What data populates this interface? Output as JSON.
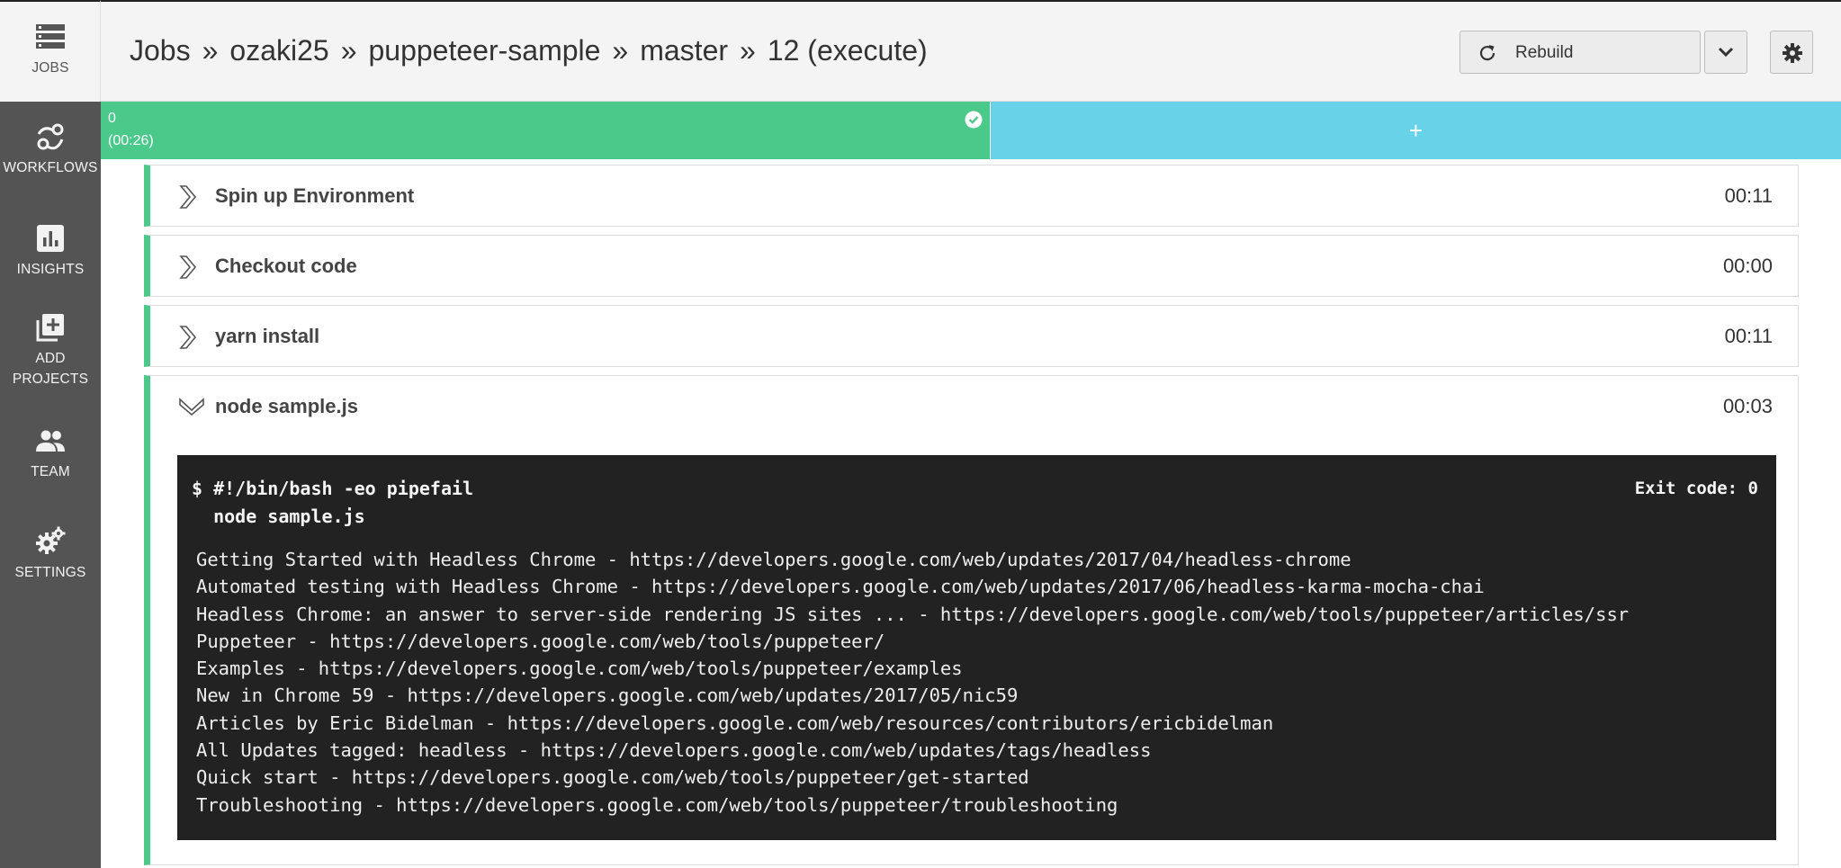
{
  "sidebar": {
    "jobs_label": "JOBS",
    "items": [
      {
        "label": "WORKFLOWS"
      },
      {
        "label": "INSIGHTS"
      },
      {
        "label": "ADD\nPROJECTS"
      },
      {
        "label": "TEAM"
      },
      {
        "label": "SETTINGS"
      }
    ]
  },
  "header": {
    "breadcrumbs": [
      "Jobs",
      "ozaki25",
      "puppeteer-sample",
      "master",
      "12 (execute)"
    ],
    "separator": "»",
    "rebuild_label": "Rebuild"
  },
  "parallel": {
    "index": "0",
    "duration": "(00:26)",
    "add_symbol": "+"
  },
  "steps": [
    {
      "name": "Spin up Environment",
      "time": "00:11",
      "expanded": false
    },
    {
      "name": "Checkout code",
      "time": "00:00",
      "expanded": false
    },
    {
      "name": "yarn install",
      "time": "00:11",
      "expanded": false
    },
    {
      "name": "node sample.js",
      "time": "00:03",
      "expanded": true
    }
  ],
  "terminal": {
    "command_line1": "$ #!/bin/bash -eo pipefail",
    "command_line2": "  node sample.js",
    "exit_code": "Exit code: 0",
    "output": [
      "Getting Started with Headless Chrome - https://developers.google.com/web/updates/2017/04/headless-chrome",
      "Automated testing with Headless Chrome - https://developers.google.com/web/updates/2017/06/headless-karma-mocha-chai",
      "Headless Chrome: an answer to server-side rendering JS sites ... - https://developers.google.com/web/tools/puppeteer/articles/ssr",
      "Puppeteer - https://developers.google.com/web/tools/puppeteer/",
      "Examples - https://developers.google.com/web/tools/puppeteer/examples",
      "New in Chrome 59 - https://developers.google.com/web/updates/2017/05/nic59",
      "Articles by Eric Bidelman - https://developers.google.com/web/resources/contributors/ericbidelman",
      "All Updates tagged: headless - https://developers.google.com/web/updates/tags/headless",
      "Quick start - https://developers.google.com/web/tools/puppeteer/get-started",
      "Troubleshooting - https://developers.google.com/web/tools/puppeteer/troubleshooting"
    ]
  },
  "colors": {
    "success": "#4bc98b",
    "add_lane": "#68d3e8",
    "sidebar": "#545454",
    "terminal_bg": "#222222"
  }
}
